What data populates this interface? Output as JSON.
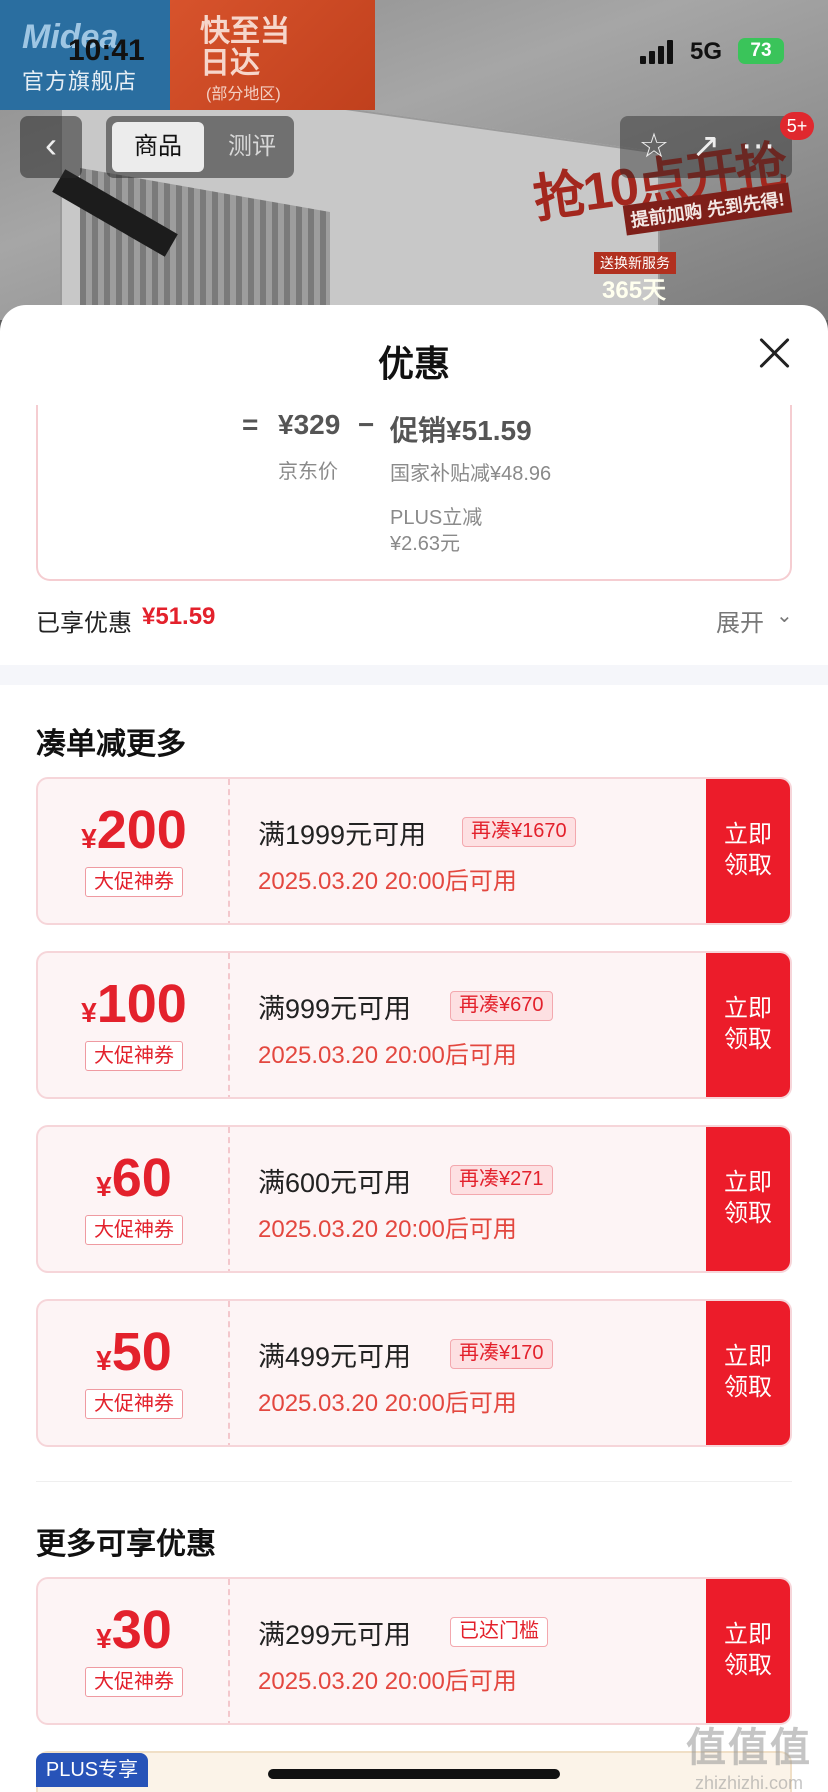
{
  "status_bar": {
    "time": "10:41",
    "network": "5G",
    "battery": "73"
  },
  "background": {
    "brand_name": "官方旗舰店",
    "brand_logo": "Midea",
    "delivery_title": "快至当日达",
    "delivery_note": "(部分地区)",
    "promo_title": "抢10点开抢",
    "promo_subtitle": "提前加购 先到先得!",
    "promo_service": "送换新服务",
    "promo_days": "365天"
  },
  "nav": {
    "back_icon": "chevron-left-icon",
    "tabs": [
      {
        "label": "商品",
        "active": true
      },
      {
        "label": "测评",
        "active": false
      }
    ],
    "badge": "5+"
  },
  "sheet": {
    "title": "优惠",
    "calc": {
      "equals": "=",
      "price": "¥329",
      "minus": "−",
      "promo": "促销¥51.59",
      "price_label": "京东价",
      "sub_1": "国家补贴减¥48.96",
      "sub_2": "PLUS立减",
      "sub_3": "¥2.63元"
    },
    "enjoyed": {
      "label": "已享优惠",
      "value": "¥51.59"
    },
    "expand_label": "展开",
    "section_1_title": "凑单减更多",
    "section_2_title": "更多可享优惠",
    "coupons": [
      {
        "amount": "200",
        "currency": "¥",
        "tag": "大促神券",
        "condition": "满1999元可用",
        "pill": "再凑¥1670",
        "time": "2025.03.20 20:00后可用",
        "button": "立即\n领取"
      },
      {
        "amount": "100",
        "currency": "¥",
        "tag": "大促神券",
        "condition": "满999元可用",
        "pill": "再凑¥670",
        "time": "2025.03.20 20:00后可用",
        "button": "立即\n领取"
      },
      {
        "amount": "60",
        "currency": "¥",
        "tag": "大促神券",
        "condition": "满600元可用",
        "pill": "再凑¥271",
        "time": "2025.03.20 20:00后可用",
        "button": "立即\n领取"
      },
      {
        "amount": "50",
        "currency": "¥",
        "tag": "大促神券",
        "condition": "满499元可用",
        "pill": "再凑¥170",
        "time": "2025.03.20 20:00后可用",
        "button": "立即\n领取"
      },
      {
        "amount": "30",
        "currency": "¥",
        "tag": "大促神券",
        "condition": "满299元可用",
        "pill": "已达门槛",
        "time": "2025.03.20 20:00后可用",
        "button": "立即\n领取"
      }
    ],
    "plus_tag": "PLUS专享"
  },
  "watermark": {
    "main": "值值值",
    "url": "zhizhizhi.com"
  },
  "colors": {
    "accent": "#e3212c",
    "button": "#ec1c2a",
    "coupon_bg": "#fdf4f5",
    "plus": "#2753b8"
  }
}
